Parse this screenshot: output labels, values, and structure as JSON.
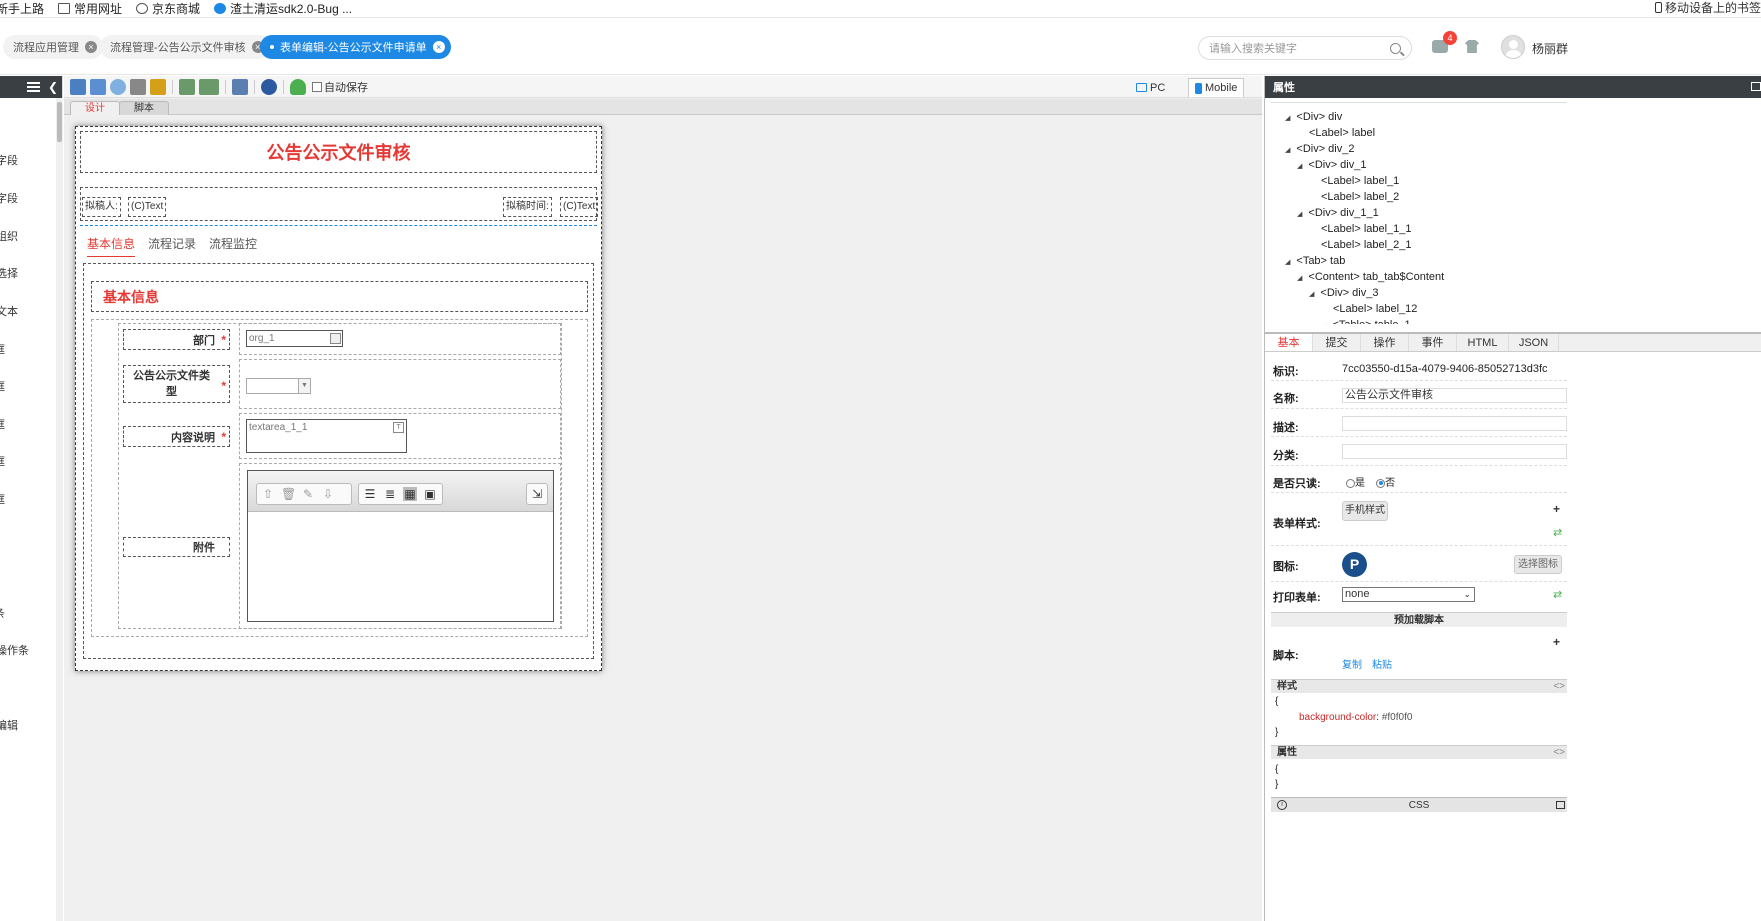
{
  "bookmarks": [
    {
      "label": "新手上路"
    },
    {
      "label": "常用网址"
    },
    {
      "label": "京东商城"
    },
    {
      "label": "渣土清运sdk2.0-Bug ..."
    }
  ],
  "bookmarks_right": "移动设备上的书签",
  "header": {
    "tabs": [
      {
        "label": "流程应用管理",
        "active": false
      },
      {
        "label": "流程管理-公告公示文件审核",
        "active": false
      },
      {
        "label": "表单编辑-公告公示文件申请单",
        "active": true
      }
    ],
    "search_placeholder": "请输入搜索关键字",
    "notification_count": "4",
    "username": "杨丽群"
  },
  "left_sidebar": {
    "items": [
      "字段",
      "字段",
      "组织",
      "选择",
      "文本",
      "框",
      "框",
      "框",
      "框",
      "框",
      "条",
      "操作条",
      "编辑"
    ]
  },
  "toolbar": {
    "autosave_label": "自动保存",
    "view_pc": "PC",
    "view_mobile": "Mobile",
    "subtab_design": "设计",
    "subtab_script": "脚本"
  },
  "form": {
    "title": "公告公示文件审核",
    "drafter_label": "拟稿人:",
    "drafter_value": "(C)Text",
    "draft_time_label": "拟稿时间:",
    "draft_time_value": "(C)Text",
    "tabs": [
      "基本信息",
      "流程记录",
      "流程监控"
    ],
    "section_title": "基本信息",
    "fields": {
      "dept_label": "部门",
      "dept_value": "org_1",
      "type_label": "公告公示文件类型",
      "content_label": "内容说明",
      "content_value": "textarea_1_1",
      "attachment_label": "附件",
      "required_mark": "*"
    }
  },
  "properties": {
    "title": "属性",
    "tree": [
      {
        "text": "<Div> div",
        "depth": 1,
        "expandable": true
      },
      {
        "text": "<Label> label",
        "depth": 2,
        "expandable": false
      },
      {
        "text": "<Div> div_2",
        "depth": 1,
        "expandable": true
      },
      {
        "text": "<Div> div_1",
        "depth": 2,
        "expandable": true
      },
      {
        "text": "<Label> label_1",
        "depth": 3,
        "expandable": false
      },
      {
        "text": "<Label> label_2",
        "depth": 3,
        "expandable": false
      },
      {
        "text": "<Div> div_1_1",
        "depth": 2,
        "expandable": true
      },
      {
        "text": "<Label> label_1_1",
        "depth": 3,
        "expandable": false
      },
      {
        "text": "<Label> label_2_1",
        "depth": 3,
        "expandable": false
      },
      {
        "text": "<Tab> tab",
        "depth": 1,
        "expandable": true
      },
      {
        "text": "<Content> tab_tab$Content",
        "depth": 2,
        "expandable": true
      },
      {
        "text": "<Div> div_3",
        "depth": 3,
        "expandable": true
      },
      {
        "text": "<Label> label_12",
        "depth": 4,
        "expandable": false
      },
      {
        "text": "<Table> table_1",
        "depth": 4,
        "expandable": true
      }
    ],
    "tabs": [
      "基本",
      "提交",
      "操作",
      "事件",
      "HTML",
      "JSON"
    ],
    "id_label": "标识:",
    "id_value": "7cc03550-d15a-4079-9406-85052713d3fc",
    "name_label": "名称:",
    "name_value": "公告公示文件审核",
    "desc_label": "描述:",
    "category_label": "分类:",
    "readonly_label": "是否只读:",
    "readonly_yes": "是",
    "readonly_no": "否",
    "form_style_label": "表单样式:",
    "form_style_button": "手机样式",
    "icon_label": "图标:",
    "icon_glyph": "P",
    "select_icon_button": "选择图标",
    "print_form_label": "打印表单:",
    "print_form_value": "none",
    "preload_script_title": "预加载脚本",
    "script_label": "脚本:",
    "copy_link": "复制",
    "paste_link": "粘贴",
    "style_header": "样式",
    "style_open": "{",
    "style_prop": "background-color",
    "style_colon": ":",
    "style_val": " #f0f0f0",
    "style_close": "}",
    "attr_header": "属性",
    "attr_open": "{",
    "attr_close": "}",
    "css_bar": "CSS",
    "code_arrows": "<>",
    "plus": "+"
  },
  "colors": {
    "accent": "#1e88e5",
    "red": "#e53935",
    "dark_header": "#3a3f44",
    "badge": "#f44336"
  }
}
